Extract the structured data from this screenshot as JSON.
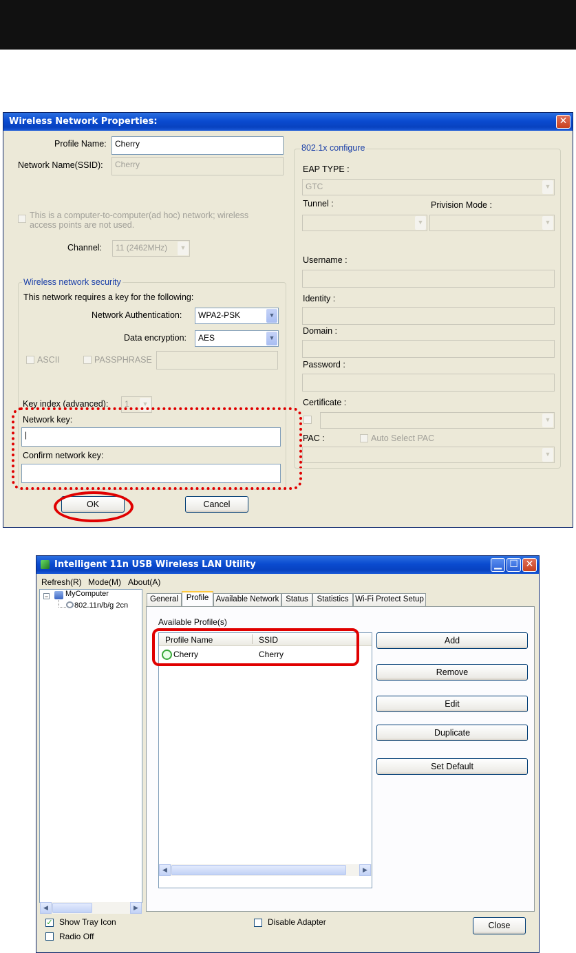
{
  "props": {
    "title": "Wireless Network Properties:",
    "profile_name_label": "Profile Name:",
    "profile_name_value": "Cherry",
    "ssid_label": "Network Name(SSID):",
    "ssid_value": "Cherry",
    "adhoc_label_line1": "This is a computer-to-computer(ad hoc) network; wireless",
    "adhoc_label_line2": "access points are not used.",
    "channel_label": "Channel:",
    "channel_value": "11 (2462MHz)",
    "security_group": "Wireless network security",
    "security_text": "This network requires a key for the following:",
    "auth_label": "Network Authentication:",
    "auth_value": "WPA2-PSK",
    "enc_label": "Data encryption:",
    "enc_value": "AES",
    "ascii_label": "ASCII",
    "passphrase_label": "PASSPHRASE",
    "key_index_label": "Key index (advanced):",
    "key_index_value": "1",
    "network_key_label": "Network key:",
    "network_key_value": "|",
    "confirm_key_label": "Confirm network key:",
    "ok_label": "OK",
    "cancel_label": "Cancel",
    "dot1x_group": "802.1x configure",
    "eap_type_label": "EAP TYPE :",
    "eap_type_value": "GTC",
    "tunnel_label": "Tunnel :",
    "provision_label": "Privision Mode :",
    "username_label": "Username :",
    "identity_label": "Identity :",
    "domain_label": "Domain :",
    "password_label": "Password :",
    "certificate_label": "Certificate :",
    "pac_label": "PAC :",
    "auto_pac_label": "Auto Select PAC"
  },
  "utility": {
    "title": "Intelligent 11n USB Wireless LAN Utility",
    "menu": [
      "Refresh(R)",
      "Mode(M)",
      "About(A)"
    ],
    "tree_root": "MyComputer",
    "tree_child": "802.11n/b/g 2cn",
    "tabs": [
      "General",
      "Profile",
      "Available Network",
      "Status",
      "Statistics",
      "Wi-Fi Protect Setup"
    ],
    "available_profiles_label": "Available Profile(s)",
    "col_profile_name": "Profile Name",
    "col_ssid": "SSID",
    "rows": [
      {
        "profile": "Cherry",
        "ssid": "Cherry"
      }
    ],
    "buttons": [
      "Add",
      "Remove",
      "Edit",
      "Duplicate",
      "Set Default"
    ],
    "show_tray_label": "Show Tray Icon",
    "radio_off_label": "Radio Off",
    "disable_adapter_label": "Disable Adapter",
    "close_label": "Close"
  },
  "colors": {
    "accent_red": "#e00000",
    "xp_blue": "#0a4bd0",
    "dialog_bg": "#ece9d8"
  }
}
